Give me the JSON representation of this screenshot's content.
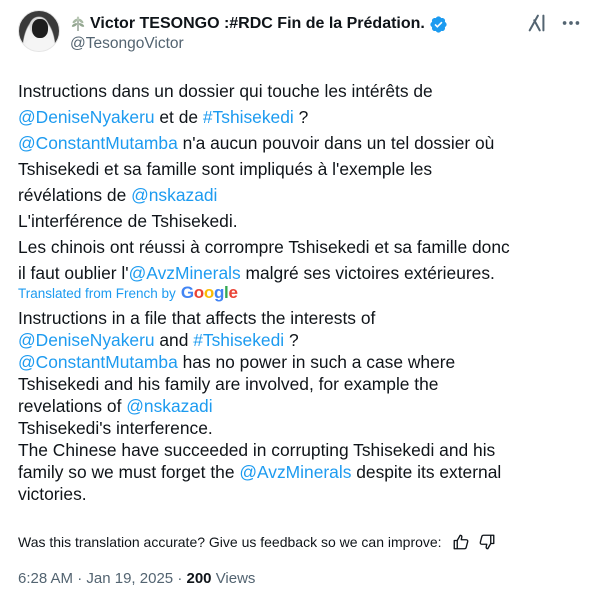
{
  "author": {
    "name_emoji_icon": "leaf-sprig-icon",
    "display_name": "Victor TESONGO :#RDC Fin de la Prédation.",
    "handle": "@TesongoVictor",
    "verified": true
  },
  "header_icons": [
    "grok-icon",
    "more-icon"
  ],
  "original_text": [
    [
      {
        "t": "Instructions dans un dossier qui touche les intérêts de"
      }
    ],
    [
      {
        "t": "@DeniseNyakeru",
        "link": true
      },
      {
        "t": " et de "
      },
      {
        "t": "#Tshisekedi",
        "link": true
      },
      {
        "t": " ?"
      }
    ],
    [
      {
        "t": "@ConstantMutamba",
        "link": true
      },
      {
        "t": " n'a aucun pouvoir dans un tel dossier où"
      }
    ],
    [
      {
        "t": "Tshisekedi et sa famille sont impliqués à l'exemple les"
      }
    ],
    [
      {
        "t": "révélations de "
      },
      {
        "t": "@nskazadi",
        "link": true
      }
    ],
    [
      {
        "t": "L'interférence de Tshisekedi."
      }
    ],
    [
      {
        "t": "Les chinois ont réussi à corrompre Tshisekedi et sa famille donc"
      }
    ],
    [
      {
        "t": "il faut oublier l'"
      },
      {
        "t": "@AvzMinerals",
        "link": true
      },
      {
        "t": " malgré ses victoires extérieures."
      }
    ]
  ],
  "translation_notice": {
    "label": "Translated from French by",
    "provider": "Google"
  },
  "translated_text": [
    [
      {
        "t": "Instructions in a file that affects the interests of"
      }
    ],
    [
      {
        "t": "@DeniseNyakeru",
        "link": true
      },
      {
        "t": " and "
      },
      {
        "t": "#Tshisekedi",
        "link": true
      },
      {
        "t": " ?"
      }
    ],
    [
      {
        "t": "@ConstantMutamba",
        "link": true
      },
      {
        "t": " has no power in such a case where"
      }
    ],
    [
      {
        "t": "Tshisekedi and his family are involved, for example the"
      }
    ],
    [
      {
        "t": "revelations of "
      },
      {
        "t": "@nskazadi",
        "link": true
      }
    ],
    [
      {
        "t": "Tshisekedi's interference."
      }
    ],
    [
      {
        "t": "The Chinese have succeeded in corrupting Tshisekedi and his"
      }
    ],
    [
      {
        "t": "family so we must forget the "
      },
      {
        "t": "@AvzMinerals",
        "link": true
      },
      {
        "t": " despite its external"
      }
    ],
    [
      {
        "t": "victories."
      }
    ]
  ],
  "feedback": {
    "question": "Was this translation accurate? Give us feedback so we can improve:",
    "icons": [
      "thumbs-up-icon",
      "thumbs-down-icon"
    ]
  },
  "meta": {
    "time": "6:28 AM",
    "date": "Jan 19, 2025",
    "views_count": "200",
    "views_label": "Views"
  },
  "colors": {
    "link": "#1d9bf0",
    "text": "#0f1419",
    "secondary": "#536471",
    "google_blue": "#4285F4",
    "google_red": "#EA4335",
    "google_yellow": "#FBBC05",
    "google_green": "#34A853"
  }
}
